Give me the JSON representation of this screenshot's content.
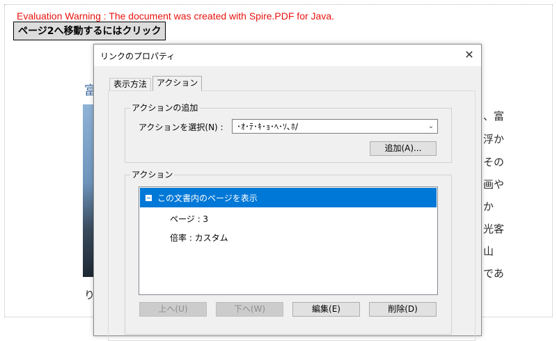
{
  "document": {
    "evaluation_warning": "Evaluation Warning : The document was created with Spire.PDF for Java.",
    "link_text": "ページ2へ移動するにはクリック",
    "background_heading_fragment": "富",
    "background_left_fragment": "り",
    "background_right_lines": [
      "、富",
      "浮か",
      "その",
      "画や",
      "か",
      "光客",
      "山",
      "であ"
    ]
  },
  "dialog": {
    "title": "リンクのプロパティ",
    "close_label": "✕",
    "tabs": [
      {
        "label": "表示方法",
        "active": false
      },
      {
        "label": "アクション",
        "active": true
      }
    ],
    "add_action_group": {
      "legend": "アクションの追加",
      "select_label": "アクションを選択(N) :",
      "select_value": "･ｵ･ﾃ･ｷ･ｮ･ﾍ･ｿ､ﾎ/",
      "add_button": "追加(A)..."
    },
    "actions_group": {
      "legend": "アクション",
      "tree": {
        "root": "この文書内のページを表示",
        "children": [
          "ページ : 3",
          "倍率 : カスタム"
        ]
      },
      "buttons": [
        {
          "label": "上へ(U)",
          "enabled": false
        },
        {
          "label": "下へ(W)",
          "enabled": false
        },
        {
          "label": "編集(E)",
          "enabled": true
        },
        {
          "label": "削除(D)",
          "enabled": true
        }
      ]
    }
  },
  "colors": {
    "warning": "#e8130f",
    "selection": "#0078d7",
    "heading": "#3d6aa0"
  }
}
